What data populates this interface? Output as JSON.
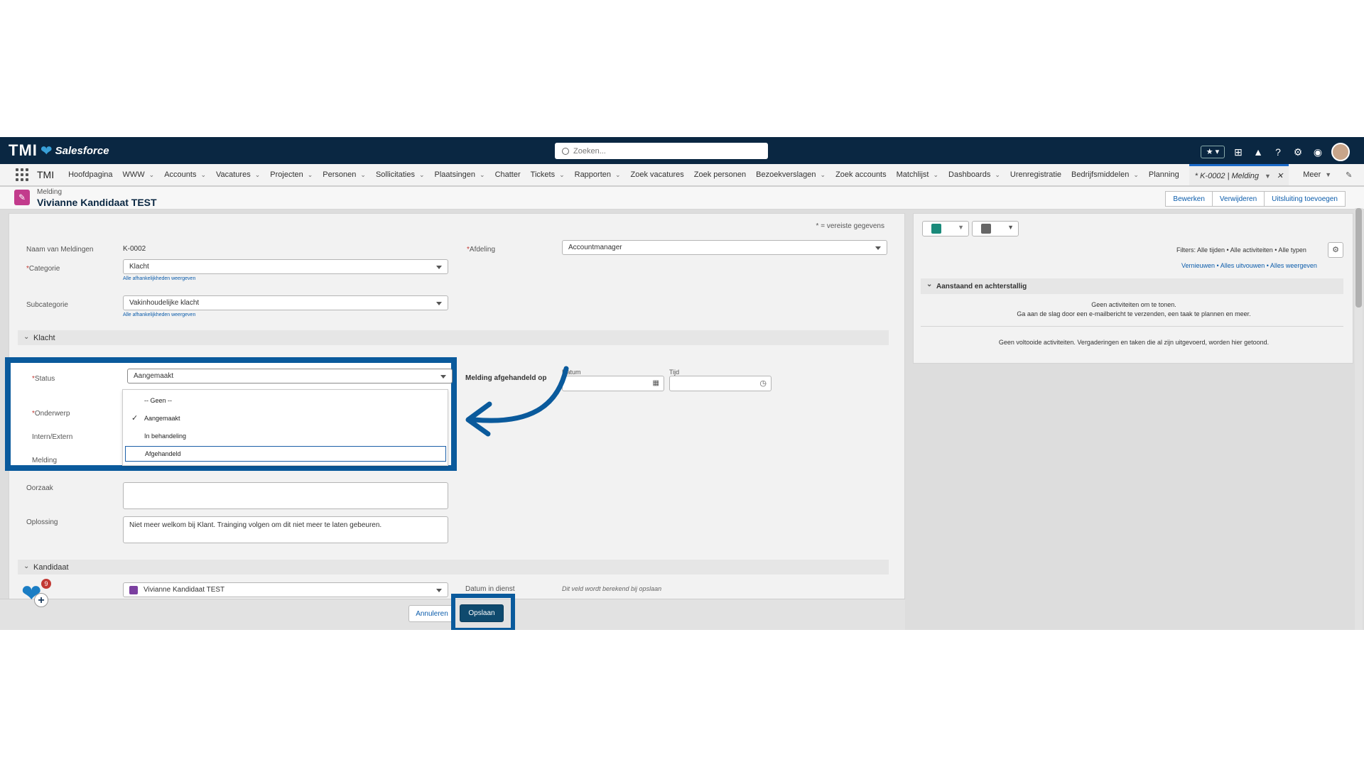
{
  "header": {
    "logo_tmi": "TMI",
    "logo_salesforce": "Salesforce",
    "search_placeholder": "Zoeken..."
  },
  "nav": {
    "app_name": "TMI",
    "items": [
      {
        "label": "Hoofdpagina",
        "chevron": false
      },
      {
        "label": "WWW",
        "chevron": true
      },
      {
        "label": "Accounts",
        "chevron": true
      },
      {
        "label": "Vacatures",
        "chevron": true
      },
      {
        "label": "Projecten",
        "chevron": true
      },
      {
        "label": "Personen",
        "chevron": true
      },
      {
        "label": "Sollicitaties",
        "chevron": true
      },
      {
        "label": "Plaatsingen",
        "chevron": true
      },
      {
        "label": "Chatter",
        "chevron": false
      },
      {
        "label": "Tickets",
        "chevron": true
      },
      {
        "label": "Rapporten",
        "chevron": true
      },
      {
        "label": "Zoek vacatures",
        "chevron": false
      },
      {
        "label": "Zoek personen",
        "chevron": false
      },
      {
        "label": "Bezoekverslagen",
        "chevron": true
      },
      {
        "label": "Zoek accounts",
        "chevron": false
      },
      {
        "label": "Matchlijst",
        "chevron": true
      },
      {
        "label": "Dashboards",
        "chevron": true
      },
      {
        "label": "Urenregistratie",
        "chevron": false
      },
      {
        "label": "Bedrijfsmiddelen",
        "chevron": true
      },
      {
        "label": "Planning",
        "chevron": false
      }
    ],
    "active_tab": "* K-0002 | Melding",
    "more": "Meer"
  },
  "record": {
    "type": "Melding",
    "title": "Vivianne Kandidaat TEST",
    "actions": [
      "Bewerken",
      "Verwijderen",
      "Uitsluiting toevoegen"
    ]
  },
  "form": {
    "required_note": "* = vereiste gegevens",
    "naam_label": "Naam van Meldingen",
    "naam_value": "K-0002",
    "afdeling_label": "Afdeling",
    "afdeling_value": "Accountmanager",
    "categorie_label": "Categorie",
    "categorie_value": "Klacht",
    "dependency_link": "Alle afhankelijkheden weergeven",
    "subcategorie_label": "Subcategorie",
    "subcategorie_value": "Vakinhoudelijke klacht",
    "section_klacht": "Klacht",
    "status_label": "Status",
    "status_value": "Aangemaakt",
    "afgehandeld_label": "Melding afgehandeld op",
    "datum_label": "Datum",
    "tijd_label": "Tijd",
    "onderwerp_label": "Onderwerp",
    "intern_label": "Intern/Extern",
    "melding_label": "Melding",
    "oorzaak_label": "Oorzaak",
    "oplossing_label": "Oplossing",
    "oplossing_value": "Niet meer welkom bij Klant. Trainging volgen om dit niet meer te laten gebeuren.",
    "section_kandidaat": "Kandidaat",
    "kandidaat_value": "Vivianne Kandidaat TEST",
    "datum_in_dienst_label": "Datum in dienst",
    "calc_note": "Dit veld wordt berekend bij opslaan",
    "cancel": "Annuleren",
    "save": "Opslaan"
  },
  "status_dropdown": {
    "options": [
      {
        "label": "-- Geen --",
        "checked": false
      },
      {
        "label": "Aangemaakt",
        "checked": true
      },
      {
        "label": "In behandeling",
        "checked": false
      },
      {
        "label": "Afgehandeld",
        "checked": false
      }
    ],
    "focused": "Afgehandeld"
  },
  "activity": {
    "filters": "Filters: Alle tijden • Alle activiteiten • Alle typen",
    "links": "Vernieuwen  •  Alles uitvouwen  •  Alles weergeven",
    "section": "Aanstaand en achterstallig",
    "empty_line1": "Geen activiteiten om te tonen.",
    "empty_line2": "Ga aan de slag door een e-mailbericht te verzenden, een taak te plannen en meer.",
    "past_note": "Geen voltooide activiteiten. Vergaderingen en taken die al zijn uitgevoerd, worden hier getoond."
  },
  "help_widget": {
    "badge": "9"
  },
  "colors": {
    "header_bg": "#0a2742",
    "highlight": "#0a5a9c",
    "save_button": "#0f4a6e",
    "link": "#0b5cab"
  }
}
